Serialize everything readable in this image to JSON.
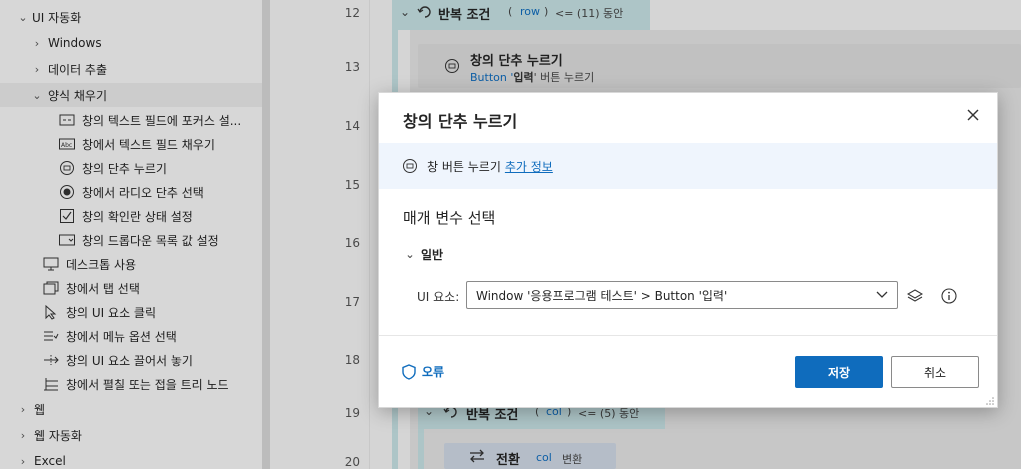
{
  "sidebar": {
    "items": [
      {
        "label": "UI 자동화",
        "chevron": "down",
        "icon": "none"
      },
      {
        "label": "Windows",
        "chevron": "right",
        "icon": "none"
      },
      {
        "label": "데이터 추출",
        "chevron": "right",
        "icon": "none"
      },
      {
        "label": "양식 채우기",
        "chevron": "down",
        "icon": "none"
      },
      {
        "label": "창의 텍스트 필드에 포커스 설...",
        "icon": "textfield-focus-icon"
      },
      {
        "label": "창에서 텍스트 필드 채우기",
        "icon": "textfield-fill-icon",
        "icon_text": "Abc"
      },
      {
        "label": "창의 단추 누르기",
        "icon": "button-press-icon"
      },
      {
        "label": "창에서 라디오 단추 선택",
        "icon": "radio-button-icon"
      },
      {
        "label": "창의 확인란 상태 설정",
        "icon": "checkbox-icon"
      },
      {
        "label": "창의 드롭다운 목록 값 설정",
        "icon": "dropdown-list-icon"
      },
      {
        "label": "데스크톱 사용",
        "icon": "desktop-icon"
      },
      {
        "label": "창에서 탭 선택",
        "icon": "tab-icon"
      },
      {
        "label": "창의 UI 요소 클릭",
        "icon": "cursor-click-icon"
      },
      {
        "label": "창에서 메뉴 옵션 선택",
        "icon": "menu-option-icon"
      },
      {
        "label": "창의 UI 요소 끌어서 놓기",
        "icon": "drag-drop-icon"
      },
      {
        "label": "창에서 펼칠 또는 접을 트리 노드",
        "icon": "tree-node-icon"
      },
      {
        "label": "웹",
        "chevron": "right",
        "icon": "none"
      },
      {
        "label": "웹 자동화",
        "chevron": "right",
        "icon": "none"
      },
      {
        "label": "Excel",
        "chevron": "right",
        "icon": "none"
      }
    ]
  },
  "flow": {
    "line_numbers": [
      "12",
      "13",
      "14",
      "15",
      "16",
      "17",
      "18",
      "19",
      "20"
    ],
    "loop_top": {
      "keyword": "반복 조건",
      "var": "row",
      "rest": "<= (11) 동안"
    },
    "step_13": {
      "title": "창의 단추 누르기",
      "desc_prefix": "Button '",
      "desc_highlight": "입력",
      "desc_suffix": "' 버튼 누르기"
    },
    "loop_bottom": {
      "keyword": "반복 조건",
      "var": "col",
      "rest": "<= (5) 동안"
    },
    "step_20": {
      "keyword": "전환",
      "var": "col",
      "rest": "변환"
    }
  },
  "dialog": {
    "title": "창의 단추 누르기",
    "info_text": "창 버튼 누르기",
    "info_link": "추가 정보",
    "section_title": "매개 변수 선택",
    "group_label": "일반",
    "ui_element_label": "UI 요소:",
    "ui_element_value": "Window '응용프로그램 테스트' > Button '입력'",
    "error_label": "오류",
    "save_label": "저장",
    "cancel_label": "취소"
  },
  "colors": {
    "accent": "#0f6cbd",
    "loop_bar": "#c5e1e3",
    "info_band": "#eff5fd"
  }
}
